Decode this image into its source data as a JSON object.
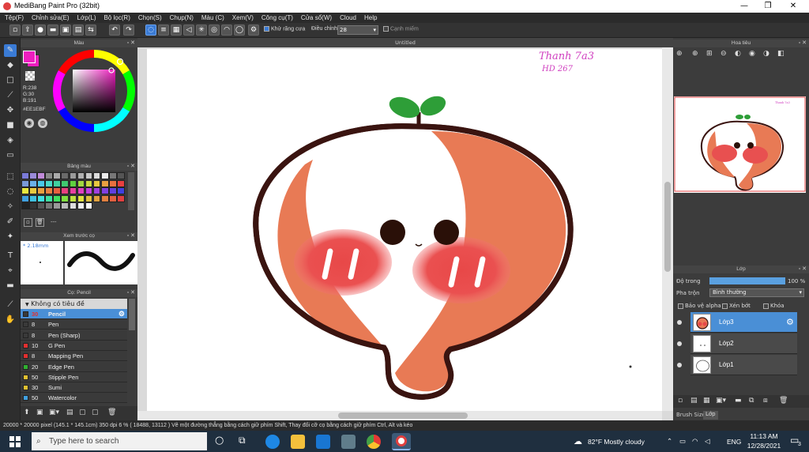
{
  "window": {
    "title": "MediBang Paint Pro (32bit)",
    "minimize": "—",
    "maximize": "❐",
    "close": "✕"
  },
  "menu": [
    "Tệp(F)",
    "Chỉnh sửa(E)",
    "Lớp(L)",
    "Bộ lọc(R)",
    "Chọn(S)",
    "Chụp(N)",
    "Màu (C)",
    "Xem(V)",
    "Công cụ(T)",
    "Cửa sổ(W)",
    "Cloud",
    "Help"
  ],
  "toolbar": {
    "antialias_label": "Khử răng cưa",
    "adjust_label": "Điều chỉnh",
    "adjust_value": "28",
    "edge_label": "Cạnh miếm"
  },
  "color_panel": {
    "title": "Màu",
    "r": "R:238",
    "g": "G:30",
    "b": "B:191",
    "hex": "#EE1EBF",
    "fg_color": "#ee1ebf"
  },
  "palette_panel": {
    "title": "Bảng màu",
    "more": "---",
    "colors": [
      "#7a7ad8",
      "#9a8ad8",
      "#c08ad8",
      "#888",
      "#aaa",
      "#6a6a6a",
      "#9a9a9a",
      "#b0b0b0",
      "#c8c8c8",
      "#dcdcdc",
      "#eaeaea",
      "#777",
      "#555",
      "#7a9ad8",
      "#6ab0e8",
      "#4ac8e8",
      "#4ad8c8",
      "#40d0a0",
      "#40c870",
      "#60d040",
      "#a0d840",
      "#c8d840",
      "#e8c840",
      "#e8a040",
      "#e87040",
      "#e84040",
      "#e8e840",
      "#e8c840",
      "#e8a040",
      "#e88040",
      "#e86040",
      "#e84080",
      "#e840a0",
      "#e040c0",
      "#c040e0",
      "#a040e0",
      "#8040e0",
      "#6040e0",
      "#4040e0",
      "#40a0e0",
      "#40c0e0",
      "#40e0e0",
      "#40e0a0",
      "#40e060",
      "#80e040",
      "#c0e040",
      "#e0e040",
      "#e0c040",
      "#e0a040",
      "#e08040",
      "#e06040",
      "#e04040",
      "#222",
      "#333",
      "#555",
      "#777",
      "#999",
      "#bbb",
      "#ddd",
      "#eee",
      "#f8f8f8"
    ]
  },
  "brush_preview": {
    "title": "Xem trước cọ",
    "size": "2.18mm"
  },
  "brush_panel": {
    "title": "Cọ: Pencil",
    "group": "Không có tiêu đề",
    "items": [
      {
        "size": "30",
        "name": "Pencil",
        "color": "#3a3a3a"
      },
      {
        "size": "8",
        "name": "Pen",
        "color": "#3a3a3a"
      },
      {
        "size": "8",
        "name": "Pen (Sharp)",
        "color": "#3a3a3a"
      },
      {
        "size": "10",
        "name": "G Pen",
        "color": "#e03030"
      },
      {
        "size": "8",
        "name": "Mapping Pen",
        "color": "#e03030"
      },
      {
        "size": "20",
        "name": "Edge Pen",
        "color": "#30b030"
      },
      {
        "size": "50",
        "name": "Stipple Pen",
        "color": "#e0c030"
      },
      {
        "size": "30",
        "name": "Sumi",
        "color": "#e0c030"
      },
      {
        "size": "50",
        "name": "Watercolor",
        "color": "#40a0e0"
      }
    ]
  },
  "canvas": {
    "title": "Untitled",
    "signature_line1": "Thanh 7a3",
    "signature_line2": "HD 267"
  },
  "navigator": {
    "title": "Hoa tiêu"
  },
  "layers": {
    "title": "Lớp",
    "opacity_label": "Độ trong",
    "opacity_value": "100 %",
    "opacity_fraction": 1.0,
    "blend_label": "Pha trộn",
    "blend_value": "Bình thường",
    "protect_alpha": "Bảo vệ alpha",
    "clip": "Xén bớt",
    "lock": "Khóa",
    "items": [
      {
        "name": "Lớp3"
      },
      {
        "name": "Lớp2"
      },
      {
        "name": "Lớp1"
      }
    ],
    "tab_brush_size": "Brush Size",
    "tab_layer": "Lớp"
  },
  "status": {
    "text": "20000 * 20000 pixel   (145.1 * 145.1cm)   350 dpi   6 %   ( 18488, 13112 )   Vẽ một đường thẳng bằng cách giữ phím Shift, Thay đổi cỡ cọ bằng cách giữ phím Ctrl, Alt và kéo"
  },
  "taskbar": {
    "search_placeholder": "Type here to search",
    "weather": "82°F  Mostly cloudy",
    "lang": "ENG",
    "time": "11:13 AM",
    "date": "12/28/2021",
    "notif_count": "3"
  }
}
